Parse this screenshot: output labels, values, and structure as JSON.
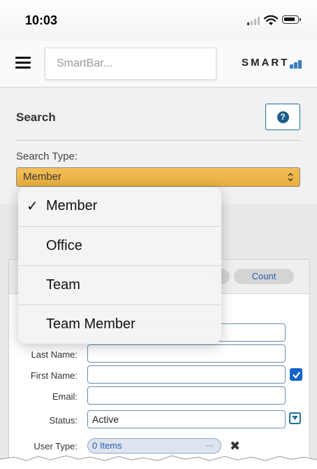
{
  "status_bar": {
    "time": "10:03"
  },
  "header": {
    "smartbar_placeholder": "SmartBar...",
    "logo_text": "SMART"
  },
  "search": {
    "title": "Search",
    "help_glyph": "?",
    "type_label": "Search Type:",
    "selected_type": "Member"
  },
  "dropdown": {
    "options": [
      {
        "label": "Member",
        "checked": true,
        "check_glyph": "✓"
      },
      {
        "label": "Office",
        "checked": false
      },
      {
        "label": "Team",
        "checked": false
      },
      {
        "label": "Team Member",
        "checked": false
      }
    ]
  },
  "panel": {
    "count_tab": "Count",
    "fields": {
      "last_name_label": "Last Name:",
      "first_name_label": "First Name:",
      "email_label": "Email:",
      "status_label": "Status:",
      "status_value": "Active",
      "user_type_label": "User Type:",
      "user_type_value": "0 Items",
      "user_type_ellipsis": "···",
      "clear_glyph": "✖"
    }
  },
  "colors": {
    "select_accent": "#f0b84e",
    "primary_blue": "#1464c8",
    "help_border": "#1f6f99",
    "logo_blue": "#3a7cc0"
  }
}
